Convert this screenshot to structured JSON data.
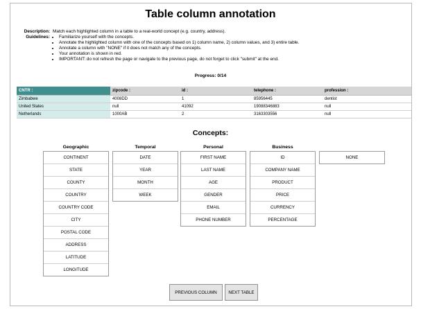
{
  "title": "Table column annotation",
  "description_label": "Description:",
  "description": "Match each highlighted column in a table to a real-world concept (e.g. country, address).",
  "guidelines_label": "Guidelines:",
  "guidelines": [
    "Familiarize yourself with the concepts.",
    "Annotate the highlighted column with one of the concepts based on 1) column name, 2) column values, and 3) entire table.",
    "Annotate a column with \"NONE\" if it does not match any of the concepts.",
    "Your annotation is shown in red.",
    "IMPORTANT: do not refresh the page or navigate to the previous page, do not forget to click \"submit\" at the end."
  ],
  "progress": "Progress: 0/14",
  "table": {
    "headers": [
      "CNTR :",
      "zipcode :",
      "id :",
      "telephone :",
      "profession :"
    ],
    "highlight_column": 0,
    "rows": [
      [
        "Zimbabwe",
        "4008DD",
        "1",
        "85956445",
        "dentist"
      ],
      [
        "United States",
        "null",
        "41092",
        "19088346883",
        "null"
      ],
      [
        "Netherlands",
        "1000AB",
        "2",
        "3163303556",
        "null"
      ]
    ]
  },
  "concepts_title": "Concepts:",
  "concept_groups": [
    {
      "title": "Geographic",
      "items": [
        "CONTINENT",
        "STATE",
        "COUNTY",
        "COUNTRY",
        "COUNTRY CODE",
        "CITY",
        "POSTAL CODE",
        "ADDRESS",
        "LATITUDE",
        "LONGITUDE"
      ]
    },
    {
      "title": "Temporal",
      "items": [
        "DATE",
        "YEAR",
        "MONTH",
        "WEEK"
      ]
    },
    {
      "title": "Personal",
      "items": [
        "FIRST NAME",
        "LAST NAME",
        "AGE",
        "GENDER",
        "EMAIL",
        "PHONE NUMBER"
      ]
    },
    {
      "title": "Business",
      "items": [
        "ID",
        "COMPANY NAME",
        "PRODUCT",
        "PRICE",
        "CURRENCY",
        "PERCENTAGE"
      ]
    },
    {
      "title": "",
      "items": [
        "NONE"
      ]
    }
  ],
  "buttons": {
    "previous": "PREVIOUS COLUMN",
    "next": "NEXT TABLE"
  },
  "colors": {
    "highlight_header": "#3f8f8f",
    "highlight_cell": "#d4ecec"
  }
}
